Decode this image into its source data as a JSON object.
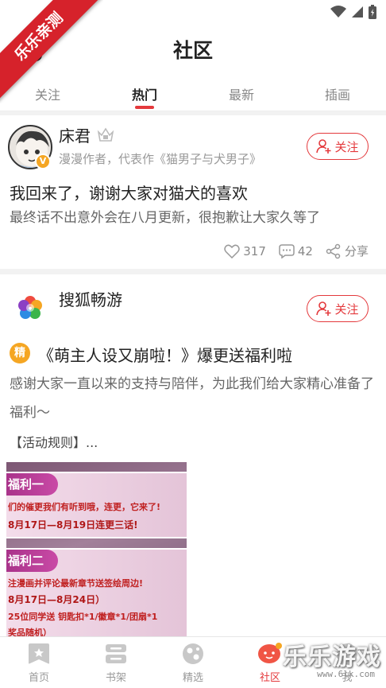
{
  "ribbon": {
    "text": "乐乐亲测"
  },
  "header": {
    "title": "社区"
  },
  "tabs": [
    {
      "label": "关注"
    },
    {
      "label": "热门"
    },
    {
      "label": "最新"
    },
    {
      "label": "插画"
    }
  ],
  "active_tab": "热门",
  "posts": [
    {
      "author": "床君",
      "author_desc": "漫漫作者，代表作《猫男子与犬男子》",
      "verified_badge": "V",
      "follow_label": "关注",
      "title": "我回来了，谢谢大家对猫犬的喜欢",
      "body": "最终话不出意外会在八月更新，很抱歉让大家久等了",
      "likes": "317",
      "comments": "42",
      "share_label": "分享"
    },
    {
      "author": "搜狐畅游",
      "follow_label": "关注",
      "tag": "精",
      "title": "《萌主人设又崩啦！》爆更送福利啦",
      "body": "感谢大家一直以来的支持与陪伴，为此我们给大家精心准备了福利～",
      "rules": "【活动规则】...",
      "image": {
        "panel1_title": "福利一",
        "panel1_line1": "们的催更我们有听到哦，连更，它来了!",
        "panel1_line2": "8月17日—8月19日连更三话!",
        "panel2_title": "福利二",
        "panel2_line1": "注漫画并评论最新章节送签绘周边!",
        "panel2_line2": "8月17日—8月24日）",
        "panel2_line3": "25位同学送 钥匙扣*1/徽章*1/团扇*1",
        "panel2_line4": "奖品随机）"
      }
    }
  ],
  "bottom_nav": [
    {
      "label": "首页"
    },
    {
      "label": "书架"
    },
    {
      "label": "精选"
    },
    {
      "label": "社区"
    },
    {
      "label": "我"
    }
  ],
  "watermark": {
    "text": "乐乐游戏",
    "url": "www.6lk.com"
  },
  "colors": {
    "accent": "#e4393c",
    "badge": "#f5a623",
    "bg": "#f2f2f2"
  }
}
